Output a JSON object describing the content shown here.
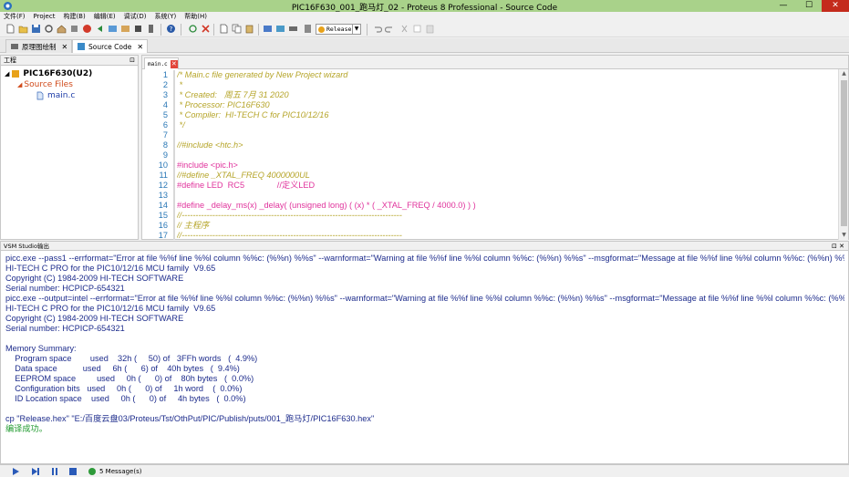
{
  "window": {
    "title": "PIC16F630_001_跑马灯_02 - Proteus 8 Professional - Source Code",
    "minimize": "—",
    "maximize": "☐",
    "close": "✕"
  },
  "menu": {
    "items": [
      "文件(F)",
      "Project",
      "构建(B)",
      "编辑(E)",
      "调试(D)",
      "系统(Y)",
      "帮助(H)"
    ]
  },
  "toolbar": {
    "build_config": "Release",
    "icons": [
      "new-file-icon",
      "open-folder-icon",
      "save-icon",
      "settings-icon",
      "stop-icon",
      "back-icon",
      "home-icon",
      "import-icon",
      "export-icon",
      "component-icon",
      "ic-icon",
      "help-icon",
      "refresh-icon",
      "delete-icon",
      "new-doc-icon",
      "copy-icon",
      "paste-icon",
      "print-icon",
      "build-icon",
      "rebuild-icon",
      "chip-icon",
      "config-icon",
      "undo-icon",
      "redo-icon",
      "cut-icon",
      "copy2-icon",
      "paste2-icon"
    ]
  },
  "tabs": [
    {
      "label": "原理图绘制",
      "icon": "schematic-icon"
    },
    {
      "label": "Source Code",
      "icon": "source-code-icon"
    }
  ],
  "project_panel": {
    "title": "工程",
    "root": "PIC16F630(U2)",
    "folder": "Source Files",
    "file": "main.c"
  },
  "editor": {
    "tab_label": "main.c",
    "line_numbers": [
      "1",
      "2",
      "3",
      "4",
      "5",
      "6",
      "7",
      "8",
      "9",
      "10",
      "11",
      "12",
      "13",
      "14",
      "15",
      "16",
      "17"
    ],
    "lines": [
      {
        "text": "/* Main.c file generated by New Project wizard",
        "style": "c-comment"
      },
      {
        "text": " *",
        "style": "c-comment"
      },
      {
        "text": " * Created:   周五 7月 31 2020",
        "style": "c-comment"
      },
      {
        "text": " * Processor: PIC16F630",
        "style": "c-comment"
      },
      {
        "text": " * Compiler:  HI-TECH C for PIC10/12/16",
        "style": "c-comment"
      },
      {
        "text": " */",
        "style": "c-comment"
      },
      {
        "text": "",
        "style": "c-comment"
      },
      {
        "text": "//#include <htc.h>",
        "style": "c-comment"
      },
      {
        "text": "",
        "style": "c-comment"
      },
      {
        "text": "#include <pic.h>",
        "style": "c-pp"
      },
      {
        "text": "//#define _XTAL_FREQ 4000000UL",
        "style": "c-comment"
      },
      {
        "text": "#define LED  RC5              //定义LED",
        "style": "c-pp"
      },
      {
        "text": "",
        "style": "c-comment"
      },
      {
        "text": "#define _delay_ms(x) _delay( (unsigned long) ( (x) * ( _XTAL_FREQ / 4000.0) ) )",
        "style": "c-pp"
      },
      {
        "text": "//-------------------------------------------------------------------------------",
        "style": "c-comment"
      },
      {
        "text": "// 主程序",
        "style": "c-comment"
      },
      {
        "text": "//-------------------------------------------------------------------------------",
        "style": "c-comment"
      }
    ]
  },
  "output_panel": {
    "title": "VSM Studio输出",
    "lines": [
      {
        "text": "picc.exe --pass1 --errformat=\"Error at file %%f line %%l column %%c: (%%n) %%s\" --warnformat=\"Warning at file %%f line %%l column %%c: (%%n) %%s\" --msgformat=\"Message at file %%f line %%l column %%c: (%%n) %%s\" --",
        "style": ""
      },
      {
        "text": "HI-TECH C PRO for the PIC10/12/16 MCU family  V9.65",
        "style": ""
      },
      {
        "text": "Copyright (C) 1984-2009 HI-TECH SOFTWARE",
        "style": ""
      },
      {
        "text": "Serial number: HCPICP-654321",
        "style": ""
      },
      {
        "text": "picc.exe --output=intel --errformat=\"Error at file %%f line %%l column %%c: (%%n) %%s\" --warnformat=\"Warning at file %%f line %%l column %%c: (%%n) %%s\" --msgformat=\"Message at file %%f line %%l column %%c: (%%n) %%",
        "style": ""
      },
      {
        "text": "HI-TECH C PRO for the PIC10/12/16 MCU family  V9.65",
        "style": ""
      },
      {
        "text": "Copyright (C) 1984-2009 HI-TECH SOFTWARE",
        "style": ""
      },
      {
        "text": "Serial number: HCPICP-654321",
        "style": ""
      },
      {
        "text": "",
        "style": ""
      },
      {
        "text": "Memory Summary:",
        "style": ""
      },
      {
        "text": "    Program space        used    32h (     50) of   3FFh words   (  4.9%)",
        "style": ""
      },
      {
        "text": "    Data space           used     6h (      6) of    40h bytes   (  9.4%)",
        "style": ""
      },
      {
        "text": "    EEPROM space         used     0h (      0) of    80h bytes   (  0.0%)",
        "style": ""
      },
      {
        "text": "    Configuration bits   used     0h (      0) of     1h word    (  0.0%)",
        "style": ""
      },
      {
        "text": "    ID Location space    used     0h (      0) of     4h bytes   (  0.0%)",
        "style": ""
      },
      {
        "text": "",
        "style": ""
      },
      {
        "text": "cp \"Release.hex\" \"E:/百度云盘03/Proteus/Tst/OthPut/PIC/Publish/puts/001_跑马灯/PIC16F630.hex\"",
        "style": ""
      },
      {
        "text": "编译成功。",
        "style": "ok"
      }
    ]
  },
  "statusbar": {
    "messages": "5 Message(s)"
  },
  "colors": {
    "titlebar": "#a9d28a",
    "comment": "#b6a52a",
    "preprocessor": "#e0339c",
    "output_text": "#1d2c8c",
    "success": "#1f9a2e",
    "line_numbers": "#2b78b6"
  }
}
